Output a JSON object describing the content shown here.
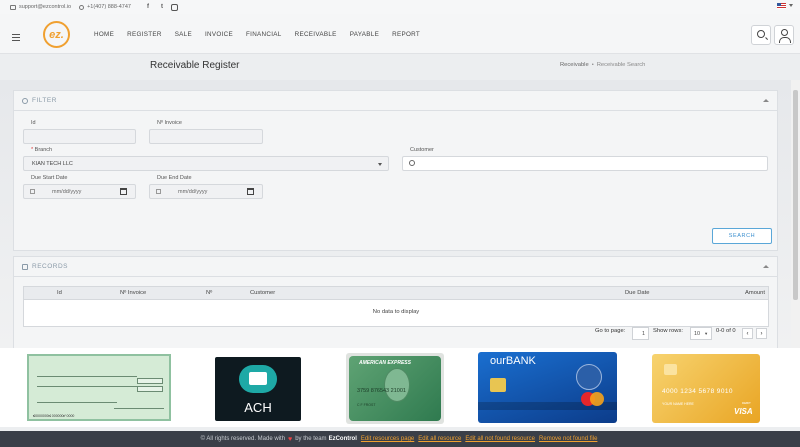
{
  "topbar": {
    "email": "support@ezcontrol.io",
    "phone": "+1(407) 888-4747",
    "social": [
      "f",
      "t",
      "ig"
    ]
  },
  "nav": {
    "logo_text": "ez.",
    "menu": [
      "HOME",
      "REGISTER",
      "SALE",
      "INVOICE",
      "FINANCIAL",
      "RECEIVABLE",
      "PAYABLE",
      "REPORT"
    ]
  },
  "page": {
    "title": "Receivable Register",
    "breadcrumb": [
      "Receivable",
      "Receivable Search"
    ]
  },
  "filter": {
    "header": "FILTER",
    "id_label": "Id",
    "invoice_label": "Nº Invoice",
    "branch_label": "Branch",
    "branch_value": "KIAN TECH LLC",
    "customer_label": "Customer",
    "due_start_label": "Due Start Date",
    "due_end_label": "Due End Date",
    "date_placeholder": "mm/dd/yyyy",
    "search_button": "SEARCH"
  },
  "records": {
    "header": "RECORDS",
    "columns": [
      "Id",
      "Nº Invoice",
      "Nº",
      "Customer",
      "Due Date",
      "Amount"
    ],
    "empty_text": "No data to display",
    "go_to_page_label": "Go to page:",
    "page_value": "1",
    "show_rows_label": "Show rows:",
    "rows_value": "10",
    "range_text": "0-0 of 0"
  },
  "payments": {
    "ach_label": "ACH",
    "amex_title": "AMERICAN EXPRESS",
    "amex_number": "3759 876543 21001",
    "amex_name": "C F FROST",
    "bank_name": "ourBANK",
    "gold_number": "4000 1234 5678 9010",
    "gold_name": "YOUR NAME HERE",
    "gold_brand": "VISA",
    "gold_debit": "DEBIT"
  },
  "footer": {
    "prefix": "© All rights reserved. Made with",
    "middle": "by the team",
    "brand": "EzControl",
    "links": [
      "Edit resources page",
      "Edit all resource",
      "Edit all not found resource",
      "Remove not found file"
    ]
  }
}
